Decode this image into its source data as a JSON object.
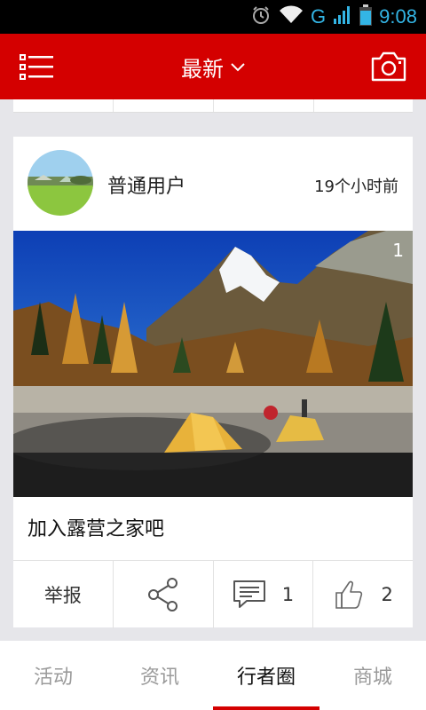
{
  "status_bar": {
    "time": "9:08",
    "network": "G"
  },
  "header": {
    "title": "最新"
  },
  "post": {
    "username": "普通用户",
    "time_ago": "19个小时前",
    "photo_count": "1",
    "text": "加入露营之家吧",
    "actions": {
      "report_label": "举报",
      "comment_count": "1",
      "like_count": "2"
    }
  },
  "tabs": [
    {
      "label": "活动"
    },
    {
      "label": "资讯"
    },
    {
      "label": "行者圈",
      "active": true
    },
    {
      "label": "商城"
    }
  ],
  "colors": {
    "brand": "#d40000",
    "status_time": "#33b5e5"
  }
}
